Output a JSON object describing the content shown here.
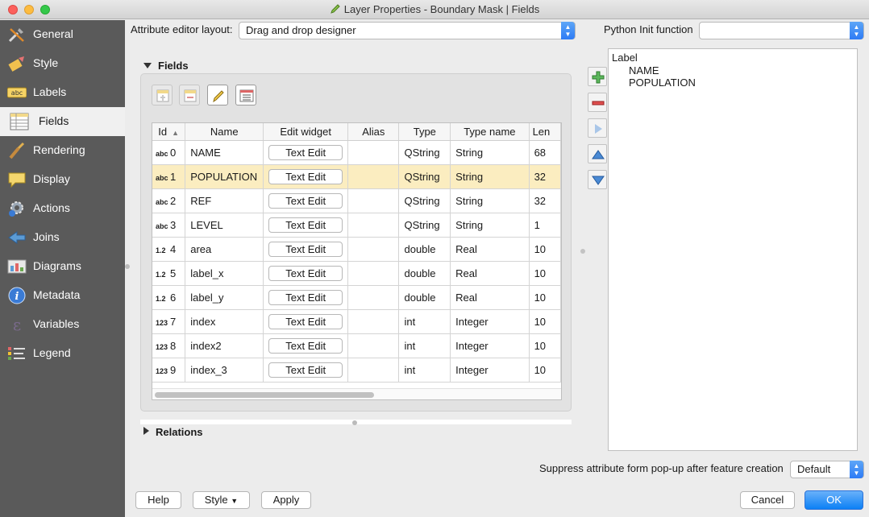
{
  "window": {
    "title": "Layer Properties - Boundary Mask | Fields"
  },
  "sidebar": {
    "items": [
      {
        "label": "General",
        "icon": "wrench-icon"
      },
      {
        "label": "Style",
        "icon": "paintbrush-icon"
      },
      {
        "label": "Labels",
        "icon": "abc-label-icon"
      },
      {
        "label": "Fields",
        "icon": "table-icon",
        "active": true
      },
      {
        "label": "Rendering",
        "icon": "brush-icon"
      },
      {
        "label": "Display",
        "icon": "speech-bubble-icon"
      },
      {
        "label": "Actions",
        "icon": "gear-play-icon"
      },
      {
        "label": "Joins",
        "icon": "join-arrow-icon"
      },
      {
        "label": "Diagrams",
        "icon": "chart-icon"
      },
      {
        "label": "Metadata",
        "icon": "info-icon"
      },
      {
        "label": "Variables",
        "icon": "epsilon-icon"
      },
      {
        "label": "Legend",
        "icon": "legend-icon"
      }
    ]
  },
  "editor": {
    "layout_label": "Attribute editor layout:",
    "layout_value": "Drag and drop designer",
    "python_label": "Python Init function",
    "python_value": ""
  },
  "fields_section": {
    "title": "Fields",
    "columns": [
      "Id",
      "Name",
      "Edit widget",
      "Alias",
      "Type",
      "Type name",
      "Len"
    ],
    "rows": [
      {
        "type_icon": "abc",
        "id": "0",
        "name": "NAME",
        "widget": "Text Edit",
        "alias": "",
        "type": "QString",
        "type_name": "String",
        "length": "68"
      },
      {
        "type_icon": "abc",
        "id": "1",
        "name": "POPULATION",
        "widget": "Text Edit",
        "alias": "",
        "type": "QString",
        "type_name": "String",
        "length": "32"
      },
      {
        "type_icon": "abc",
        "id": "2",
        "name": "REF",
        "widget": "Text Edit",
        "alias": "",
        "type": "QString",
        "type_name": "String",
        "length": "32"
      },
      {
        "type_icon": "abc",
        "id": "3",
        "name": "LEVEL",
        "widget": "Text Edit",
        "alias": "",
        "type": "QString",
        "type_name": "String",
        "length": "1"
      },
      {
        "type_icon": "1.2",
        "id": "4",
        "name": "area",
        "widget": "Text Edit",
        "alias": "",
        "type": "double",
        "type_name": "Real",
        "length": "10"
      },
      {
        "type_icon": "1.2",
        "id": "5",
        "name": "label_x",
        "widget": "Text Edit",
        "alias": "",
        "type": "double",
        "type_name": "Real",
        "length": "10"
      },
      {
        "type_icon": "1.2",
        "id": "6",
        "name": "label_y",
        "widget": "Text Edit",
        "alias": "",
        "type": "double",
        "type_name": "Real",
        "length": "10"
      },
      {
        "type_icon": "123",
        "id": "7",
        "name": "index",
        "widget": "Text Edit",
        "alias": "",
        "type": "int",
        "type_name": "Integer",
        "length": "10"
      },
      {
        "type_icon": "123",
        "id": "8",
        "name": "index2",
        "widget": "Text Edit",
        "alias": "",
        "type": "int",
        "type_name": "Integer",
        "length": "10"
      },
      {
        "type_icon": "123",
        "id": "9",
        "name": "index_3",
        "widget": "Text Edit",
        "alias": "",
        "type": "int",
        "type_name": "Integer",
        "length": "10"
      }
    ]
  },
  "relations_section": {
    "title": "Relations"
  },
  "form_tree": {
    "header": "Label",
    "items": [
      "NAME",
      "POPULATION"
    ]
  },
  "suppress": {
    "label": "Suppress attribute form pop-up after feature creation",
    "value": "Default"
  },
  "buttons": {
    "help": "Help",
    "style": "Style",
    "apply": "Apply",
    "cancel": "Cancel",
    "ok": "OK"
  },
  "colors": {
    "sidebar_bg": "#5a5a5a",
    "selected_row": "#fbedc0",
    "accent": "#2e7bf5"
  }
}
